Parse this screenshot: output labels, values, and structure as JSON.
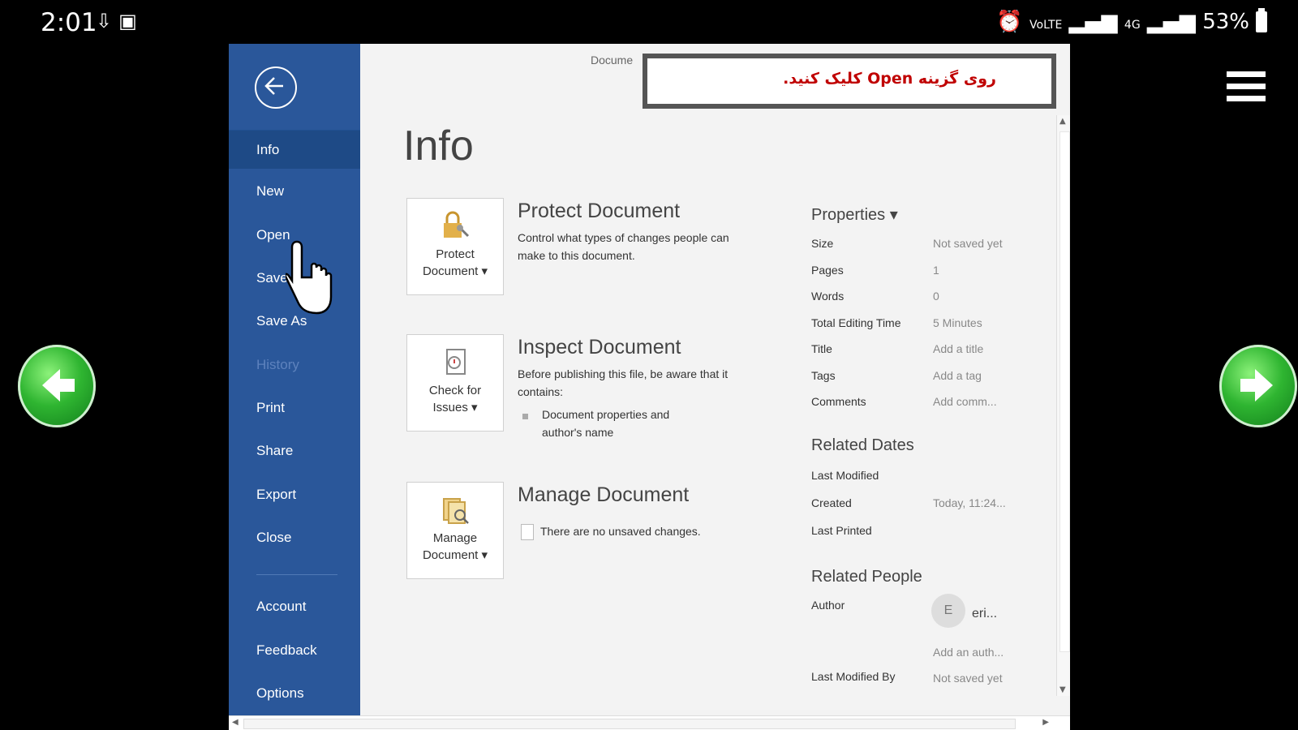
{
  "status_bar": {
    "time": "2:01",
    "left_icons": [
      "download-speed-icon",
      "image-icon"
    ],
    "right_text": "53%",
    "right_icons": [
      "alarm-icon",
      "volte-icon",
      "signal-icon",
      "4g-icon",
      "signal-icon",
      "battery-icon"
    ]
  },
  "window": {
    "doc_label": "Docume",
    "callout": "روی گزینه Open کلیک کنید."
  },
  "backstage": {
    "items": [
      {
        "label": "Info",
        "state": "active"
      },
      {
        "label": "New"
      },
      {
        "label": "Open"
      },
      {
        "label": "Save"
      },
      {
        "label": "Save As"
      },
      {
        "label": "History",
        "state": "disabled"
      },
      {
        "label": "Print"
      },
      {
        "label": "Share"
      },
      {
        "label": "Export"
      },
      {
        "label": "Close"
      },
      {
        "label": "Account"
      },
      {
        "label": "Feedback"
      },
      {
        "label": "Options"
      }
    ]
  },
  "main": {
    "title": "Info",
    "sections": [
      {
        "tile_label": [
          "Protect",
          "Document ▾"
        ],
        "title": "Protect Document",
        "desc": "Control what types of changes people can make to this document.",
        "icon": "lock-icon"
      },
      {
        "tile_label": [
          "Check for",
          "Issues ▾"
        ],
        "title": "Inspect Document",
        "desc": "Before publishing this file, be aware that it contains:",
        "bullet": "Document properties and author's name",
        "icon": "inspect-icon"
      },
      {
        "tile_label": [
          "Manage",
          "Document ▾"
        ],
        "title": "Manage Document",
        "desc": "There are no unsaved changes.",
        "icon": "manage-icon"
      }
    ]
  },
  "properties": {
    "header": "Properties ▾",
    "rows": [
      {
        "label": "Size",
        "value": "Not saved yet"
      },
      {
        "label": "Pages",
        "value": "1"
      },
      {
        "label": "Words",
        "value": "0"
      },
      {
        "label": "Total Editing Time",
        "value": "5 Minutes"
      },
      {
        "label": "Title",
        "value": "Add a title"
      },
      {
        "label": "Tags",
        "value": "Add a tag"
      },
      {
        "label": "Comments",
        "value": "Add comm..."
      }
    ],
    "related_dates_header": "Related Dates",
    "dates": [
      {
        "label": "Last Modified",
        "value": ""
      },
      {
        "label": "Created",
        "value": "Today, 11:24..."
      },
      {
        "label": "Last Printed",
        "value": ""
      }
    ],
    "related_people_header": "Related People",
    "author_label": "Author",
    "author_initial": "E",
    "author_name": "eri...",
    "add_author": "Add an auth...",
    "last_modified_by_label": "Last Modified By",
    "last_modified_by_value": "Not saved yet"
  }
}
